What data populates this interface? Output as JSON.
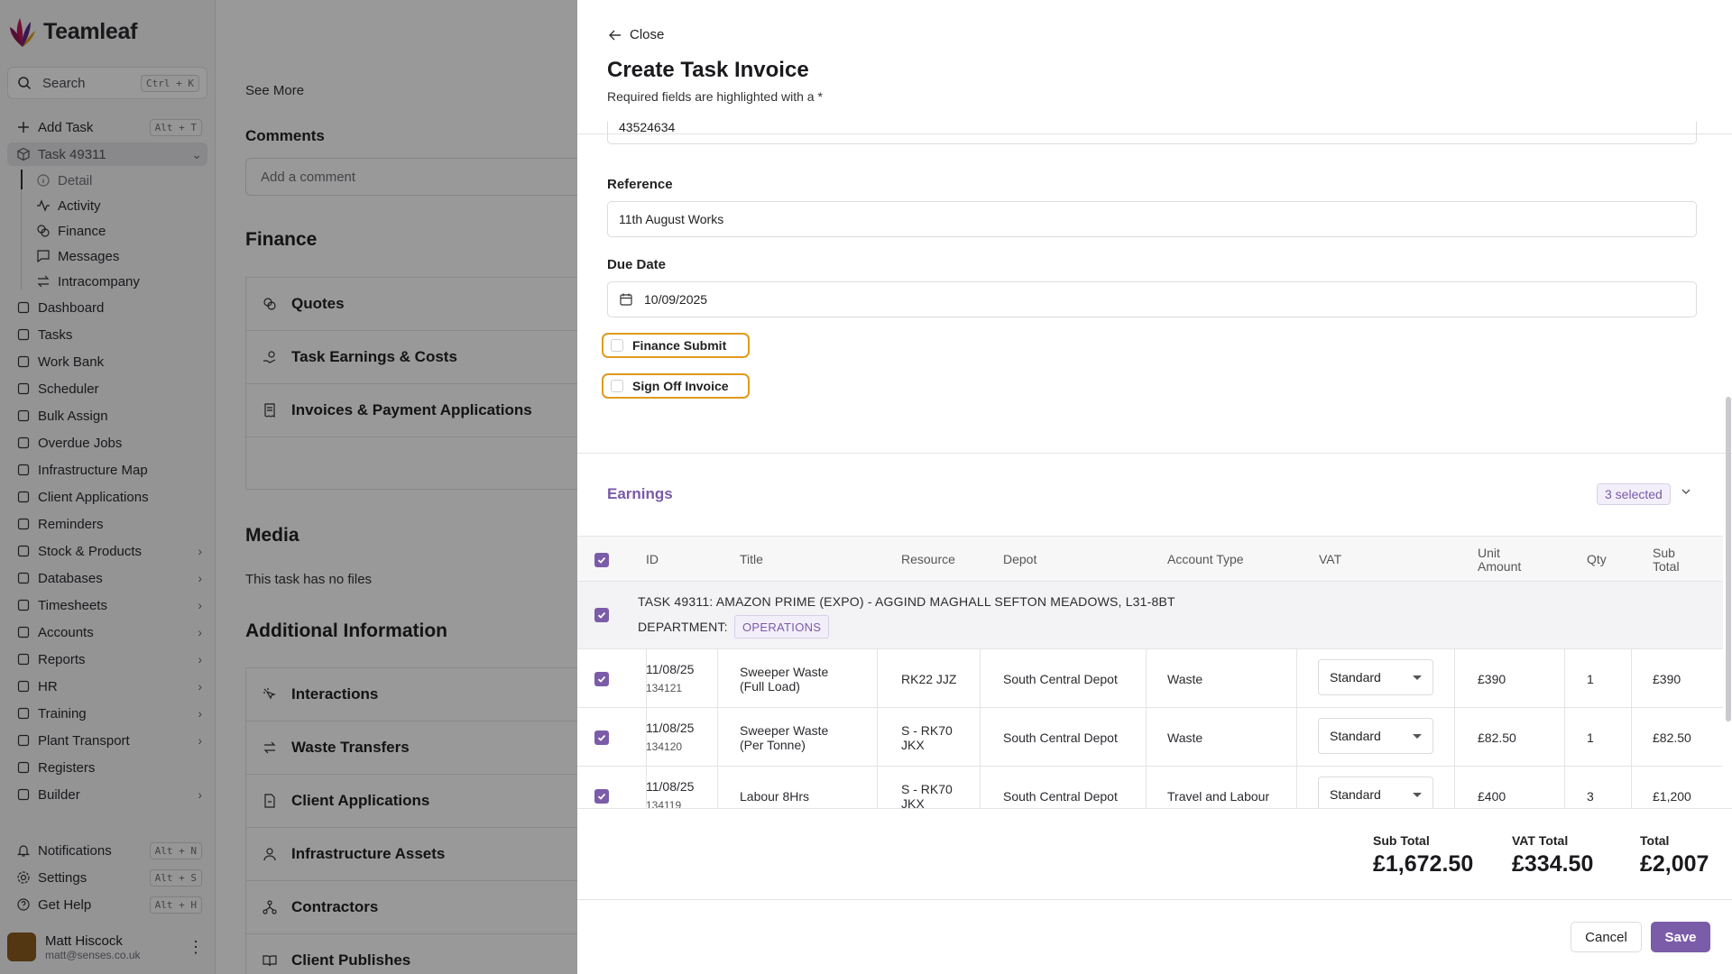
{
  "colors": {
    "accent": "#7b5ca9",
    "warning_outline": "#e09a1d",
    "overlay": "rgba(0,0,0,0.40)"
  },
  "sidebar": {
    "brand": "Teamleaf",
    "search": {
      "label": "Search",
      "shortcut": "Ctrl + K"
    },
    "add_task": {
      "label": "Add Task",
      "shortcut": "Alt + T"
    },
    "task": {
      "label": "Task 49311"
    },
    "task_sub": [
      "Detail",
      "Activity",
      "Finance",
      "Messages",
      "Intracompany"
    ],
    "items": [
      {
        "label": "Dashboard",
        "icon": "home-icon"
      },
      {
        "label": "Tasks",
        "icon": "check-square-icon"
      },
      {
        "label": "Work Bank",
        "icon": "clipboard-icon"
      },
      {
        "label": "Scheduler",
        "icon": "calendar-icon"
      },
      {
        "label": "Bulk Assign",
        "icon": "calendar-plus-icon"
      },
      {
        "label": "Overdue Jobs",
        "icon": "warning-icon"
      },
      {
        "label": "Infrastructure Map",
        "icon": "map-icon"
      },
      {
        "label": "Client Applications",
        "icon": "message-square-icon"
      },
      {
        "label": "Reminders",
        "icon": "list-checks-icon"
      },
      {
        "label": "Stock & Products",
        "icon": "boxes-icon"
      },
      {
        "label": "Databases",
        "icon": "database-icon"
      },
      {
        "label": "Timesheets",
        "icon": "clock-icon"
      },
      {
        "label": "Accounts",
        "icon": "pound-icon"
      },
      {
        "label": "Reports",
        "icon": "bar-chart-icon"
      },
      {
        "label": "HR",
        "icon": "users-icon"
      },
      {
        "label": "Training",
        "icon": "graduation-cap-icon"
      },
      {
        "label": "Plant Transport",
        "icon": "truck-icon"
      },
      {
        "label": "Registers",
        "icon": "book-icon"
      },
      {
        "label": "Builder",
        "icon": "layout-icon"
      }
    ],
    "bottom": [
      {
        "label": "Notifications",
        "shortcut": "Alt + N"
      },
      {
        "label": "Settings",
        "shortcut": "Alt + S"
      },
      {
        "label": "Get Help",
        "shortcut": "Alt + H"
      }
    ],
    "user": {
      "name": "Matt Hiscock",
      "email": "matt@senses.co.uk"
    }
  },
  "main": {
    "see_more": "See More",
    "comments_title": "Comments",
    "comment_placeholder": "Add a comment",
    "finance_title": "Finance",
    "finance_items": [
      "Quotes",
      "Task Earnings & Costs",
      "Invoices & Payment Applications"
    ],
    "media_title": "Media",
    "media_empty": "This task has no files",
    "additional_title": "Additional Information",
    "additional_items": [
      "Interactions",
      "Waste Transfers",
      "Client Applications",
      "Infrastructure Assets",
      "Contractors",
      "Client Publishes"
    ]
  },
  "drawer": {
    "close": "Close",
    "title": "Create Task Invoice",
    "subtitle": "Required fields are highlighted with a *",
    "po_value": "43524634",
    "reference_label": "Reference",
    "reference_value": "11th August Works",
    "due_label": "Due Date",
    "due_value": "10/09/2025",
    "finance_submit": "Finance Submit",
    "sign_off": "Sign Off Invoice",
    "earnings_title": "Earnings",
    "selected_badge": "3 selected",
    "columns": {
      "id": "ID",
      "title": "Title",
      "resource": "Resource",
      "depot": "Depot",
      "account_type": "Account Type",
      "vat": "VAT",
      "unit_amount": "Unit Amount",
      "qty": "Qty",
      "sub_total": "Sub Total"
    },
    "group": {
      "text": "TASK 49311: AMAZON PRIME (EXPO) - AGGIND MAGHALL SEFTON MEADOWS, L31-8BT",
      "department_label": "DEPARTMENT:",
      "department": "OPERATIONS"
    },
    "rows": [
      {
        "date": "11/08/25",
        "code": "134121",
        "title": "Sweeper Waste (Full Load)",
        "resource": "RK22 JJZ",
        "depot": "South Central Depot",
        "account_type": "Waste",
        "vat": "Standard",
        "unit_amount": "£390",
        "qty": "1",
        "sub_total": "£390"
      },
      {
        "date": "11/08/25",
        "code": "134120",
        "title": "Sweeper Waste (Per Tonne)",
        "resource": "S - RK70 JKX",
        "depot": "South Central Depot",
        "account_type": "Waste",
        "vat": "Standard",
        "unit_amount": "£82.50",
        "qty": "1",
        "sub_total": "£82.50"
      },
      {
        "date": "11/08/25",
        "code": "134119",
        "title": "Labour 8Hrs",
        "resource": "S - RK70 JKX",
        "depot": "South Central Depot",
        "account_type": "Travel and Labour",
        "vat": "Standard",
        "unit_amount": "£400",
        "qty": "3",
        "sub_total": "£1,200"
      }
    ],
    "totals": {
      "sub_total_label": "Sub Total",
      "sub_total": "£1,672.50",
      "vat_total_label": "VAT Total",
      "vat_total": "£334.50",
      "total_label": "Total",
      "total": "£2,007"
    },
    "cancel": "Cancel",
    "save": "Save"
  }
}
